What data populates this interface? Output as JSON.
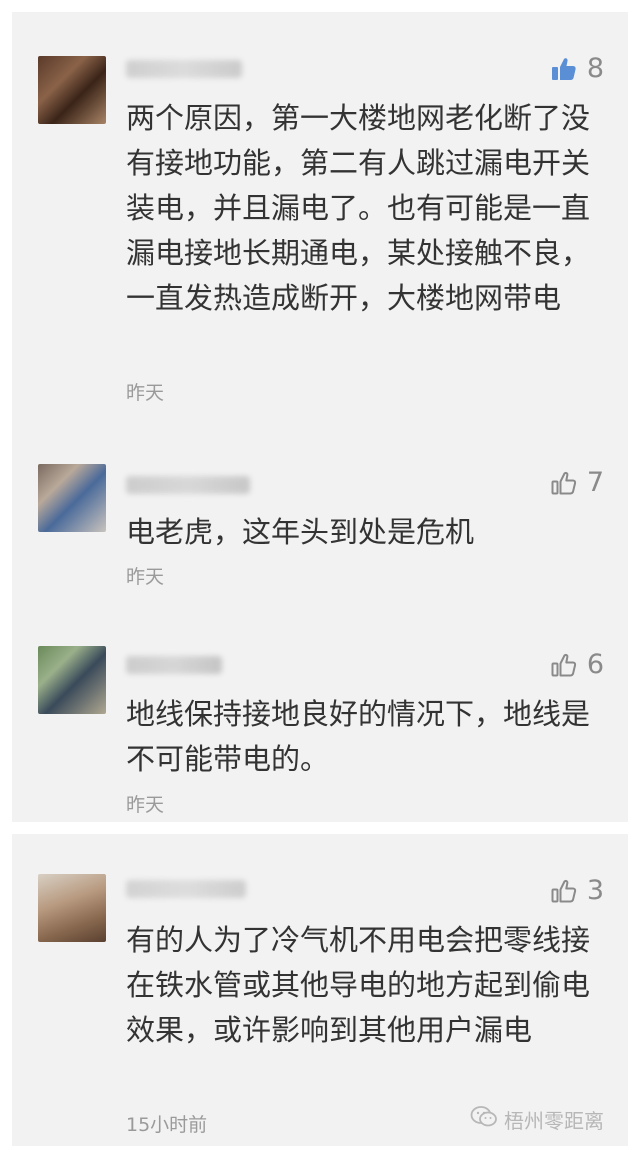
{
  "comments": [
    {
      "likes": "8",
      "text": "两个原因，第一大楼地网老化断了没有接地功能，第二有人跳过漏电开关装电，并且漏电了。也有可能是一直漏电接地长期通电，某处接触不良，一直发热造成断开，大楼地网带电",
      "time": "昨天",
      "liked": true
    },
    {
      "likes": "7",
      "text": "电老虎，这年头到处是危机",
      "time": "昨天",
      "liked": false
    },
    {
      "likes": "6",
      "text": "地线保持接地良好的情况下，地线是不可能带电的。",
      "time": "昨天",
      "liked": false
    },
    {
      "likes": "3",
      "text": "有的人为了冷气机不用电会把零线接在铁水管或其他导电的地方起到偷电效果，或许影响到其他用户漏电",
      "time": "15小时前",
      "liked": false
    }
  ],
  "watermark": {
    "text": "梧州零距离"
  },
  "colors": {
    "liked": "#5a8fd6",
    "icon": "#8a8a8a",
    "text": "#333333",
    "meta": "#9a9a9a"
  }
}
